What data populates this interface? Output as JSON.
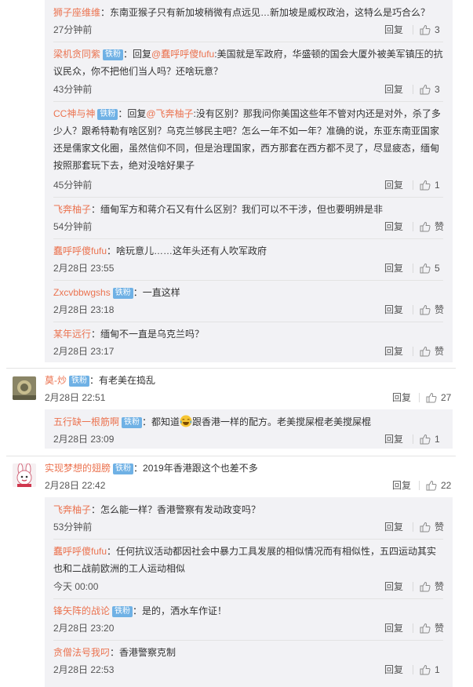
{
  "common": {
    "reply_label": "回复",
    "badge_label": "铁粉"
  },
  "block1": [
    {
      "user": "狮子座维维",
      "text": "：东南亚猴子只有新加坡稍微有点远见…新加坡是威权政治，这特么是巧合么？",
      "time": "27分钟前",
      "likes": "3"
    },
    {
      "user": "梁机贪同紫",
      "prefix": "：回复",
      "mention": "@蠢呼呼傻fufu",
      "text": ":美国就是军政府，华盛顿的国会大厦外被美军镇压的抗议民众，你不把他们当人吗？还啥玩意？",
      "time": "43分钟前",
      "likes": "3"
    },
    {
      "user": "CC神与神",
      "prefix": "：回复",
      "mention": "@飞奔柚子",
      "text": ":没有区别？那我问你美国这些年不管对内还是对外，杀了多少人？跟希特勒有啥区别？乌克兰够民主吧？怎么一年不如一年？准确的说，东亚东南亚国家还是儒家文化圈，虽然信仰不同，但是治理国家，西方那套在西方都不灵了，尽显疲态，缅甸按照那套玩下去，绝对没啥好果子",
      "time": "45分钟前",
      "likes": "1"
    },
    {
      "user": "飞奔柚子",
      "text": "：缅甸军方和蒋介石又有什么区别？我们可以不干涉，但也要明辨是非",
      "time": "54分钟前",
      "likes": "赞"
    },
    {
      "user": "蠢呼呼傻fufu",
      "text": "：啥玩意儿……这年头还有人吹军政府",
      "time": "2月28日 23:55",
      "likes": "5"
    },
    {
      "user": "Zxcvbbwgshs",
      "text": "：一直这样",
      "time": "2月28日 23:18",
      "likes": "赞"
    },
    {
      "user": "某年远行",
      "text": "：缅甸不一直是乌克兰吗？",
      "time": "2月28日 23:17",
      "likes": "赞"
    }
  ],
  "comment2": {
    "user": "莫-炒",
    "text": "：有老美在捣乱",
    "time": "2月28日 22:51",
    "likes": "27"
  },
  "block2": [
    {
      "user": "五行缺一根筋啊",
      "text_before": "：都知道",
      "emoji": "laugh-cry",
      "text_after": "跟香港一样的配方。老美搅屎棍老美搅屎棍",
      "time": "2月28日 23:09",
      "likes": "1"
    }
  ],
  "comment3": {
    "user": "实现梦想的翅膀",
    "text": "：2019年香港跟这个也差不多",
    "time": "2月28日 22:42",
    "likes": "22"
  },
  "block3": [
    {
      "user": "飞奔柚子",
      "text": "：怎么能一样？香港警察有发动政变吗？",
      "time": "53分钟前",
      "likes": "赞"
    },
    {
      "user": "蠢呼呼傻fufu",
      "text": "：任何抗议活动都因社会中暴力工具发展的相似情况而有相似性，五四运动其实也和二战前欧洲的工人运动相似",
      "time": "今天 00:00",
      "likes": "赞"
    },
    {
      "user": "锋矢阵的战论",
      "text": "：是的，洒水车作证！",
      "time": "2月28日 23:20",
      "likes": "赞"
    },
    {
      "user": "贪僧法号我叼",
      "text": "：香港警察克制",
      "time": "2月28日 22:53",
      "likes": "1"
    }
  ],
  "colors": {
    "username": "#eb7350",
    "badge": "#6fb1e5",
    "reply_bg": "#f2f2f5"
  }
}
